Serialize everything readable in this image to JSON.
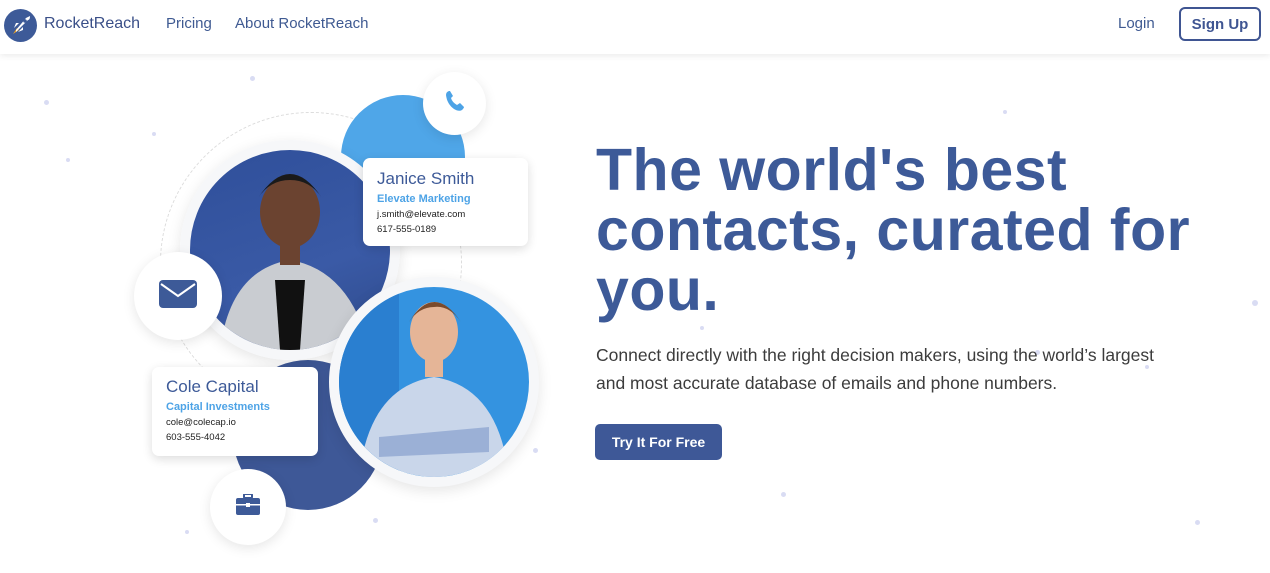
{
  "nav": {
    "brand": "RocketReach",
    "links": [
      "Pricing",
      "About RocketReach"
    ],
    "login": "Login",
    "signup": "Sign Up"
  },
  "hero": {
    "headline": "The world's best contacts, curated for you.",
    "subtext": "Connect directly with the right decision makers, using the world’s largest and most accurate database of emails and phone numbers.",
    "cta": "Try It For Free"
  },
  "cards": [
    {
      "name": "Janice Smith",
      "company": "Elevate Marketing",
      "email": "j.smith@elevate.com",
      "phone": "617-555-0189"
    },
    {
      "name": "Cole Capital",
      "company": "Capital Investments",
      "email": "cole@colecap.io",
      "phone": "603-555-4042"
    }
  ],
  "icons": [
    "phone-icon",
    "email-icon",
    "briefcase-icon"
  ],
  "colors": {
    "primary": "#3d5a98",
    "accent": "#4da3e6"
  }
}
